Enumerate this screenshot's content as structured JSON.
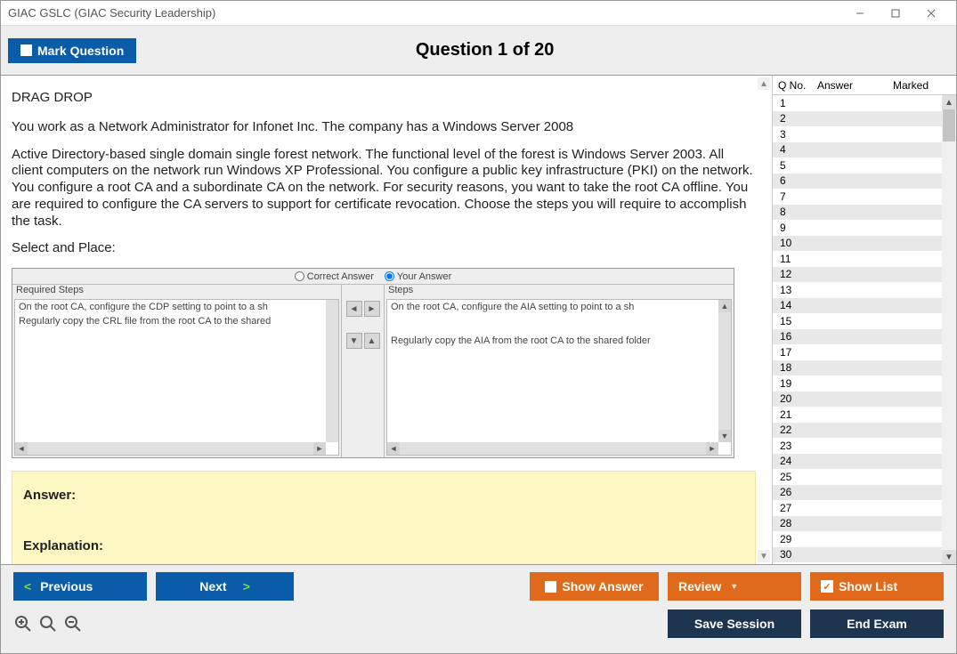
{
  "title": "GIAC GSLC (GIAC Security Leadership)",
  "toolbar": {
    "mark_label": "Mark Question",
    "heading": "Question 1 of 20"
  },
  "question": {
    "type_label": "DRAG DROP",
    "para1": "You work as a Network Administrator for Infonet Inc. The company has a Windows Server 2008",
    "para2": "Active Directory-based single domain single forest network. The functional level of the forest is Windows Server 2003. All client computers on the network run Windows XP Professional. You configure a public key infrastructure (PKI) on the network. You configure a root CA and a subordinate CA on the network. For security reasons, you want to take the root CA offline. You are required to configure the CA servers to support for certificate revocation. Choose the steps you will require to accomplish the task.",
    "select_label": "Select and Place:"
  },
  "dd": {
    "correct_label": "Correct Answer",
    "your_label": "Your Answer",
    "required_label": "Required Steps",
    "steps_label": "Steps",
    "left1": "On the root CA, configure the CDP setting to point to a sh",
    "left2": "Regularly copy the CRL file from the root CA to the shared",
    "right1": "On the root CA, configure the AIA setting to point to a sh",
    "right2": "Regularly copy the AIA from the root CA to the shared folder"
  },
  "answer_box": {
    "answer_label": "Answer:",
    "expl_label": "Explanation:"
  },
  "sidebar": {
    "h_qno": "Q No.",
    "h_ans": "Answer",
    "h_mark": "Marked",
    "rows": [
      1,
      2,
      3,
      4,
      5,
      6,
      7,
      8,
      9,
      10,
      11,
      12,
      13,
      14,
      15,
      16,
      17,
      18,
      19,
      20,
      21,
      22,
      23,
      24,
      25,
      26,
      27,
      28,
      29,
      30
    ]
  },
  "buttons": {
    "previous": "Previous",
    "next": "Next",
    "show_answer": "Show Answer",
    "review": "Review",
    "show_list": "Show List",
    "save_session": "Save Session",
    "end_exam": "End Exam"
  }
}
